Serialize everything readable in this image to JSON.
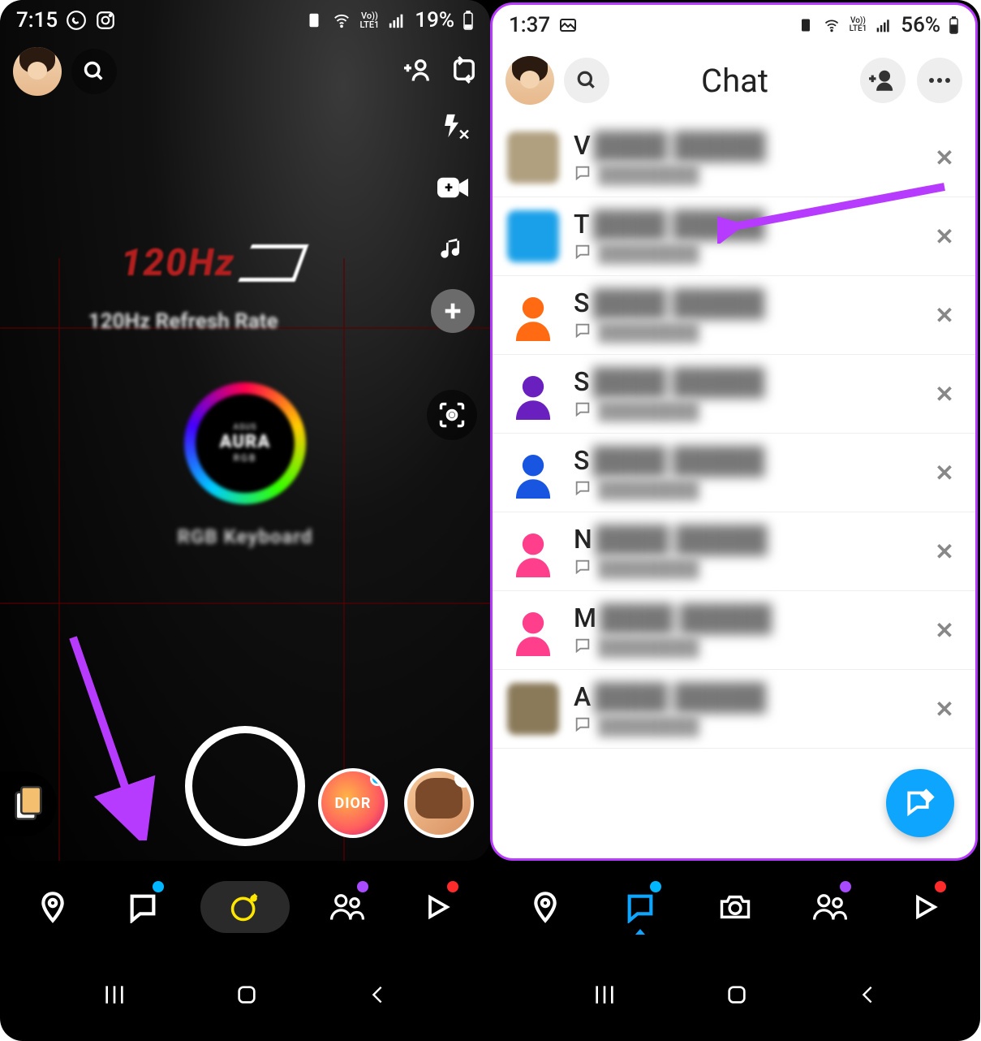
{
  "left": {
    "statusbar": {
      "time": "7:15",
      "battery": "19%"
    },
    "camera_mock": {
      "hz_text": "120Hz",
      "refresh_text": "120Hz Refresh Rate",
      "aura_top": "ASUS",
      "aura_main": "AURA",
      "aura_sub": "RGB",
      "keyboard_text": "RGB Keyboard"
    },
    "lens": {
      "dior_label": "DIOR"
    },
    "nav_dots": {
      "chat": "#00b6ff",
      "friends": "#a84bff",
      "play": "#ff2a2a"
    }
  },
  "right": {
    "statusbar": {
      "time": "1:37",
      "battery": "56%"
    },
    "header": {
      "title": "Chat"
    },
    "rows": [
      {
        "initial": "V",
        "avatar_type": "photo",
        "avatar_color": "#b0a080"
      },
      {
        "initial": "T",
        "avatar_type": "photo",
        "avatar_color": "#1aa0e8"
      },
      {
        "initial": "S",
        "avatar_type": "sil",
        "avatar_color": "#ff6a13"
      },
      {
        "initial": "S",
        "avatar_type": "sil",
        "avatar_color": "#6a1fbf"
      },
      {
        "initial": "S",
        "avatar_type": "sil",
        "avatar_color": "#1855e0"
      },
      {
        "initial": "N",
        "avatar_type": "sil",
        "avatar_color": "#ff3e8c"
      },
      {
        "initial": "M",
        "avatar_type": "sil",
        "avatar_color": "#ff3e8c"
      },
      {
        "initial": "A",
        "avatar_type": "photo",
        "avatar_color": "#8a7a5a"
      }
    ]
  }
}
